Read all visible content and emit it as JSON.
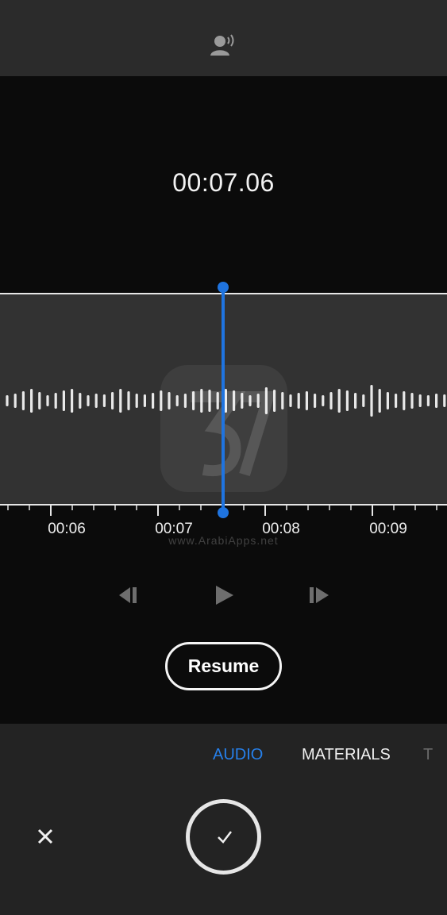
{
  "header": {
    "voice_icon": "voice-over-icon"
  },
  "recorder": {
    "elapsed_time": "00:07.06",
    "timeline_labels": [
      "00:06",
      "00:07",
      "00:08",
      "00:09"
    ]
  },
  "watermark": {
    "text": "www.ArabiApps.net",
    "logo_icon": "arabiapps-logo-icon"
  },
  "transport": {
    "step_back_icon": "step-backward-icon",
    "play_icon": "play-icon",
    "step_forward_icon": "step-forward-icon",
    "resume_label": "Resume"
  },
  "tabs": [
    {
      "label": "AUDIO",
      "active": true
    },
    {
      "label": "MATERIALS",
      "active": false
    },
    {
      "label": "T",
      "active": false
    }
  ],
  "actions": {
    "cancel_icon": "close-icon",
    "confirm_icon": "checkmark-icon"
  },
  "colors": {
    "accent": "#1f74e0",
    "active_tab": "#2680eb",
    "panel": "#323232",
    "background": "#0b0b0b"
  }
}
